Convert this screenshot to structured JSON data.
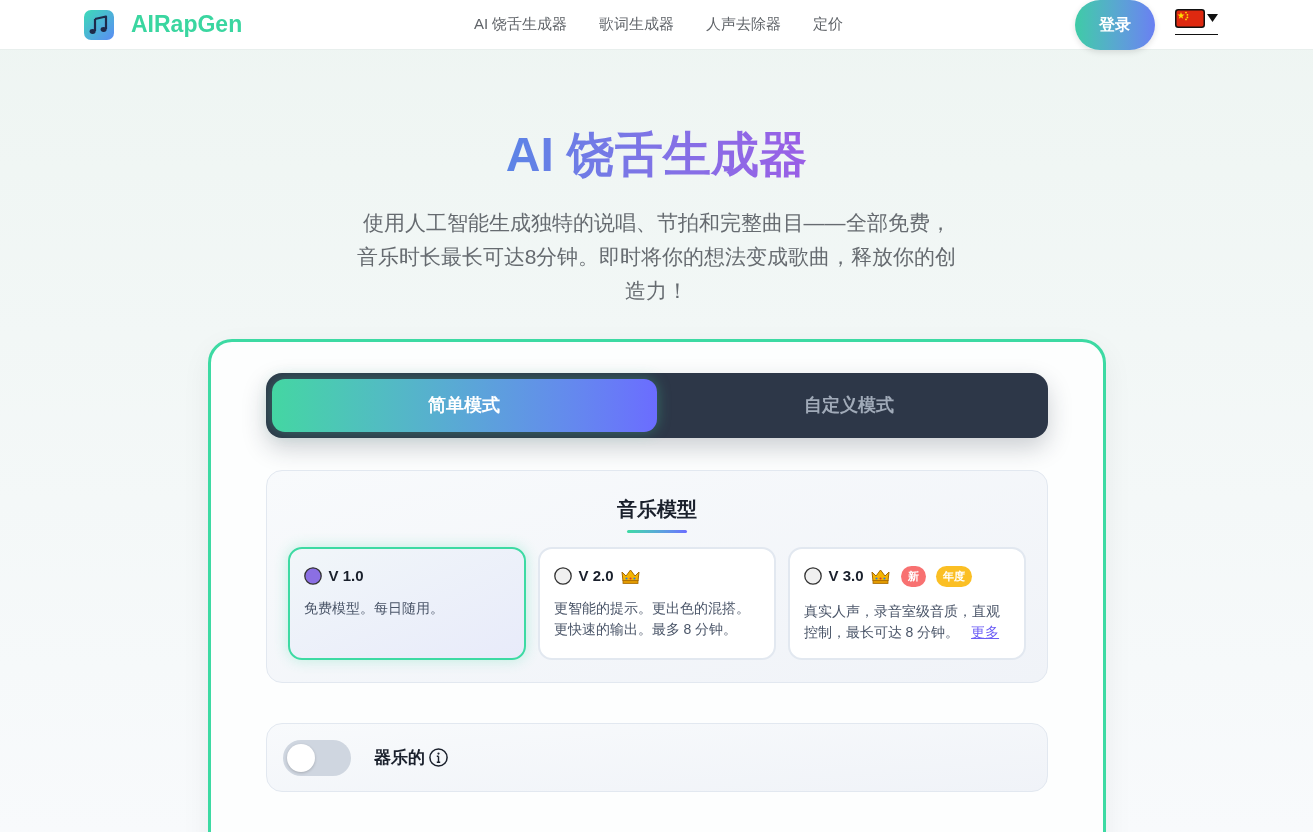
{
  "header": {
    "brand": "AIRapGen",
    "nav": [
      {
        "label": "AI 饶舌生成器"
      },
      {
        "label": "歌词生成器"
      },
      {
        "label": "人声去除器"
      },
      {
        "label": "定价"
      }
    ],
    "login_button": "登录"
  },
  "hero": {
    "title": "AI 饶舌生成器",
    "subtitle": "使用人工智能生成独特的说唱、节拍和完整曲目——全部免费，音乐时长最长可达8分钟。即时将你的想法变成歌曲，释放你的创造力！"
  },
  "mode_tabs": [
    {
      "label": "简单模式",
      "selected": true
    },
    {
      "label": "自定义模式",
      "selected": false
    }
  ],
  "music_model": {
    "heading": "音乐模型",
    "options": [
      {
        "name": "V 1.0",
        "selected": true,
        "premium": false,
        "description": "免费模型。每日随用。"
      },
      {
        "name": "V 2.0",
        "selected": false,
        "premium": true,
        "description": "更智能的提示。更出色的混搭。更快速的输出。最多 8 分钟。"
      },
      {
        "name": "V 3.0",
        "selected": false,
        "premium": true,
        "badges": [
          {
            "label": "新",
            "color": "#f87171"
          },
          {
            "label": "年度",
            "color": "#fbbf24"
          }
        ],
        "description": "真实人声，录音室级音质，直观控制，最长可达 8 分钟。",
        "link": "更多"
      }
    ]
  },
  "instrumental": {
    "label": "器乐的",
    "on": false
  }
}
